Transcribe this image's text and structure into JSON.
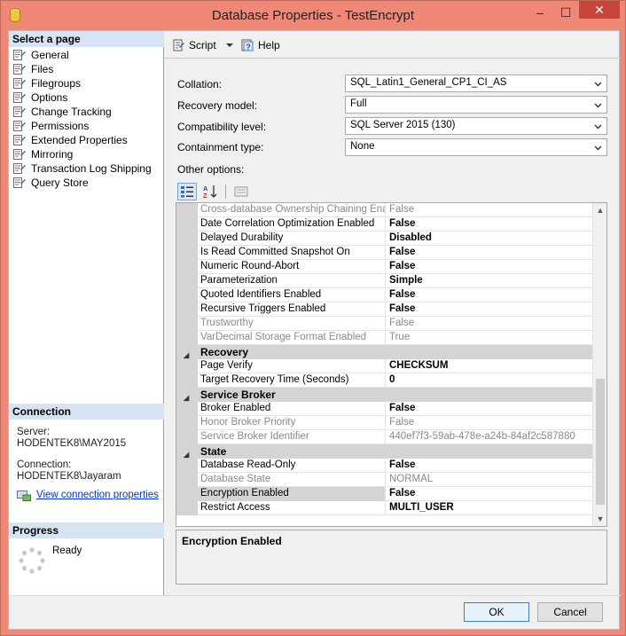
{
  "window": {
    "title": "Database Properties - TestEncrypt",
    "minimize": "–",
    "maximize": "☐",
    "close": "✕"
  },
  "select_page": {
    "header": "Select a page",
    "items": [
      {
        "label": "General"
      },
      {
        "label": "Files"
      },
      {
        "label": "Filegroups"
      },
      {
        "label": "Options"
      },
      {
        "label": "Change Tracking"
      },
      {
        "label": "Permissions"
      },
      {
        "label": "Extended Properties"
      },
      {
        "label": "Mirroring"
      },
      {
        "label": "Transaction Log Shipping"
      },
      {
        "label": "Query Store"
      }
    ]
  },
  "connection": {
    "header": "Connection",
    "server_label": "Server:",
    "server_value": "HODENTEK8\\MAY2015",
    "connection_label": "Connection:",
    "connection_value": "HODENTEK8\\Jayaram",
    "link": "View connection properties"
  },
  "progress": {
    "header": "Progress",
    "status": "Ready"
  },
  "toolbar": {
    "script_label": "Script",
    "help_label": "Help"
  },
  "form": {
    "collation_label": "Collation:",
    "collation_value": "SQL_Latin1_General_CP1_CI_AS",
    "recovery_label": "Recovery model:",
    "recovery_value": "Full",
    "compat_label": "Compatibility level:",
    "compat_value": "SQL Server 2015 (130)",
    "containment_label": "Containment type:",
    "containment_value": "None",
    "other_label": "Other options:"
  },
  "grid": {
    "rows": [
      {
        "kind": "prop",
        "name": "Cross-database Ownership Chaining Enabled",
        "value": "False",
        "dim": true
      },
      {
        "kind": "prop",
        "name": "Date Correlation Optimization Enabled",
        "value": "False"
      },
      {
        "kind": "prop",
        "name": "Delayed Durability",
        "value": "Disabled"
      },
      {
        "kind": "prop",
        "name": "Is Read Committed Snapshot On",
        "value": "False"
      },
      {
        "kind": "prop",
        "name": "Numeric Round-Abort",
        "value": "False"
      },
      {
        "kind": "prop",
        "name": "Parameterization",
        "value": "Simple"
      },
      {
        "kind": "prop",
        "name": "Quoted Identifiers Enabled",
        "value": "False"
      },
      {
        "kind": "prop",
        "name": "Recursive Triggers Enabled",
        "value": "False"
      },
      {
        "kind": "prop",
        "name": "Trustworthy",
        "value": "False",
        "dim": true
      },
      {
        "kind": "prop",
        "name": "VarDecimal Storage Format Enabled",
        "value": "True",
        "dim": true
      },
      {
        "kind": "cat",
        "name": "Recovery"
      },
      {
        "kind": "prop",
        "name": "Page Verify",
        "value": "CHECKSUM"
      },
      {
        "kind": "prop",
        "name": "Target Recovery Time (Seconds)",
        "value": "0"
      },
      {
        "kind": "cat",
        "name": "Service Broker"
      },
      {
        "kind": "prop",
        "name": "Broker Enabled",
        "value": "False"
      },
      {
        "kind": "prop",
        "name": "Honor Broker Priority",
        "value": "False",
        "dim": true
      },
      {
        "kind": "prop",
        "name": "Service Broker Identifier",
        "value": "440ef7f3-59ab-478e-a24b-84af2c587880",
        "dim": true
      },
      {
        "kind": "cat",
        "name": "State"
      },
      {
        "kind": "prop",
        "name": "Database Read-Only",
        "value": "False"
      },
      {
        "kind": "prop",
        "name": "Database State",
        "value": "NORMAL",
        "dim": true
      },
      {
        "kind": "prop",
        "name": "Encryption Enabled",
        "value": "False",
        "selected": true
      },
      {
        "kind": "prop",
        "name": "Restrict Access",
        "value": "MULTI_USER"
      }
    ],
    "category_toggle": "◢"
  },
  "description": {
    "title": "Encryption Enabled"
  },
  "buttons": {
    "ok": "OK",
    "cancel": "Cancel"
  },
  "colors": {
    "title_bar": "#f08878",
    "close_button": "#c7463c",
    "section_header": "#d6e3f2",
    "link": "#0033cc"
  }
}
